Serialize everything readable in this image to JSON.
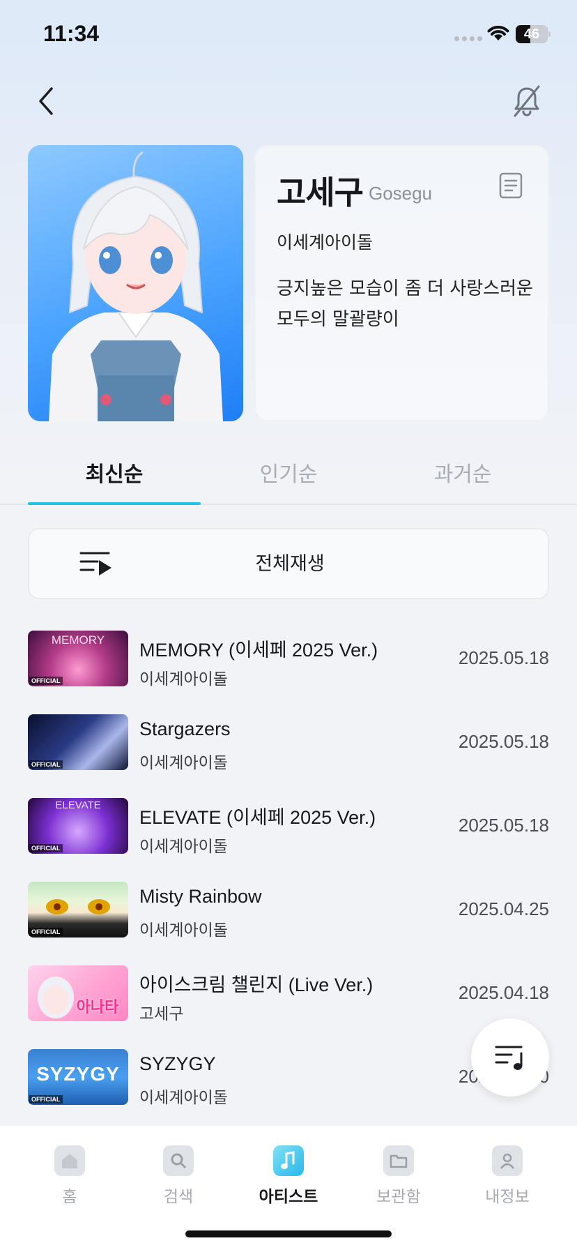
{
  "status_bar": {
    "time": "11:34",
    "battery": "46",
    "battery_level": 0.46
  },
  "header": {
    "back_icon": "chevron-left-icon",
    "bell_icon": "bell-off-icon"
  },
  "artist": {
    "name": "고세구",
    "name_en": "Gosegu",
    "group": "이세계아이돌",
    "description": "긍지높은 모습이 좀 더 사랑스러운 모두의 말괄량이"
  },
  "tabs": [
    {
      "label": "최신순",
      "active": true
    },
    {
      "label": "인기순",
      "active": false
    },
    {
      "label": "과거순",
      "active": false
    }
  ],
  "play_all": {
    "label": "전체재생"
  },
  "songs": [
    {
      "title": "MEMORY (이세페 2025 Ver.)",
      "artist": "이세계아이돌",
      "date": "2025.05.18",
      "thumb_text": "MEMORY",
      "thumb_badge": "OFFICIAL"
    },
    {
      "title": "Stargazers",
      "artist": "이세계아이돌",
      "date": "2025.05.18",
      "thumb_text": "",
      "thumb_badge": "OFFICIAL"
    },
    {
      "title": "ELEVATE (이세페 2025 Ver.)",
      "artist": "이세계아이돌",
      "date": "2025.05.18",
      "thumb_text": "ELEVATE",
      "thumb_badge": "OFFICIAL"
    },
    {
      "title": "Misty Rainbow",
      "artist": "이세계아이돌",
      "date": "2025.04.25",
      "thumb_text": "",
      "thumb_badge": "OFFICIAL"
    },
    {
      "title": "아이스크림 챌린지 (Live Ver.)",
      "artist": "고세구",
      "date": "2025.04.18",
      "thumb_text": "아나타",
      "thumb_badge": ""
    },
    {
      "title": "SYZYGY",
      "artist": "이세계아이돌",
      "date": "2025.03.20",
      "thumb_text": "SYZYGY",
      "thumb_badge": "OFFICIAL"
    }
  ],
  "bottom_nav": [
    {
      "label": "홈",
      "icon": "home-icon",
      "active": false
    },
    {
      "label": "검색",
      "icon": "search-icon",
      "active": false
    },
    {
      "label": "아티스트",
      "icon": "music-note-icon",
      "active": true
    },
    {
      "label": "보관함",
      "icon": "folder-icon",
      "active": false
    },
    {
      "label": "내정보",
      "icon": "user-icon",
      "active": false
    }
  ],
  "colors": {
    "accent": "#22c3e6",
    "background": "#f1f3f7"
  }
}
